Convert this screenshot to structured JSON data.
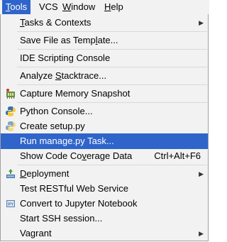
{
  "menubar": {
    "items": [
      {
        "label": "Tools",
        "mnemonic": "T",
        "rest": "ools"
      },
      {
        "label": "VCS"
      },
      {
        "label": "Window",
        "mnemonic": "W",
        "rest": "indow"
      },
      {
        "label": "Help",
        "mnemonic": "H",
        "rest": "elp"
      }
    ]
  },
  "tools_menu": {
    "items": [
      {
        "label": "Tasks & Contexts",
        "pre": "",
        "mn": "T",
        "post": "asks & Contexts",
        "arrow": "▶"
      },
      {
        "label": "Save File as Template...",
        "pre": "Save File as Temp",
        "mn": "l",
        "post": "ate..."
      },
      {
        "label": "IDE Scripting Console",
        "pre": "IDE Scripting Console",
        "mn": "",
        "post": ""
      },
      {
        "label": "Analyze Stacktrace...",
        "pre": "Analyze ",
        "mn": "S",
        "post": "tacktrace..."
      },
      {
        "label": "Capture Memory Snapshot",
        "pre": "Capture Memory Snapshot",
        "mn": "",
        "post": "",
        "icon": "memory-snapshot-icon"
      },
      {
        "label": "Python Console...",
        "pre": "Python Console...",
        "mn": "",
        "post": "",
        "icon": "python-icon"
      },
      {
        "label": "Create setup.py",
        "pre": "Create setup.py",
        "mn": "",
        "post": "",
        "icon": "python-icon"
      },
      {
        "label": "Run manage.py Task...",
        "pre": "Run manage.py Task...",
        "mn": "",
        "post": "",
        "selected": true
      },
      {
        "label": "Show Code Coverage Data",
        "pre": "Show Code Co",
        "mn": "v",
        "post": "erage Data",
        "shortcut": "Ctrl+Alt+F6"
      },
      {
        "label": "Deployment",
        "pre": "",
        "mn": "D",
        "post": "eployment",
        "icon": "deployment-icon",
        "arrow": "▶"
      },
      {
        "label": "Test RESTful Web Service",
        "pre": "Test RESTful Web Service",
        "mn": "",
        "post": ""
      },
      {
        "label": "Convert to Jupyter Notebook",
        "pre": "Convert to Jupyter Notebook",
        "mn": "",
        "post": "",
        "icon": "jupyter-icon"
      },
      {
        "label": "Start SSH session...",
        "pre": "Start SSH session...",
        "mn": "",
        "post": ""
      },
      {
        "label": "Vagrant",
        "pre": "Vagrant",
        "mn": "",
        "post": "",
        "arrow": "▶"
      }
    ]
  },
  "colors": {
    "selection": "#2f65ca",
    "menu_bg": "#f2f2f2"
  }
}
